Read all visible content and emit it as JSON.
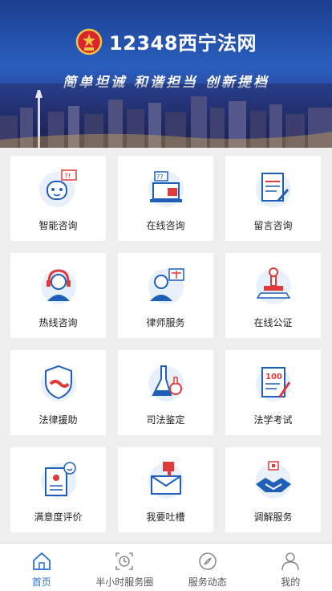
{
  "header": {
    "site_title": "12348西宁法网",
    "slogan": "简单坦诚  和谐担当  创新提档"
  },
  "services": [
    {
      "label": "智能咨询",
      "icon": "robot-icon"
    },
    {
      "label": "在线咨询",
      "icon": "laptop-chat-icon"
    },
    {
      "label": "留言咨询",
      "icon": "document-pen-icon"
    },
    {
      "label": "热线咨询",
      "icon": "headset-agent-icon"
    },
    {
      "label": "律师服务",
      "icon": "lawyer-icon"
    },
    {
      "label": "在线公证",
      "icon": "stamp-icon"
    },
    {
      "label": "法律援助",
      "icon": "shield-handshake-icon"
    },
    {
      "label": "司法鉴定",
      "icon": "flask-icon"
    },
    {
      "label": "法学考试",
      "icon": "exam-paper-icon"
    },
    {
      "label": "满意度评价",
      "icon": "rating-card-icon"
    },
    {
      "label": "我要吐槽",
      "icon": "complaint-mail-icon"
    },
    {
      "label": "调解服务",
      "icon": "handshake-icon"
    }
  ],
  "tabbar": {
    "items": [
      {
        "label": "首页",
        "icon": "home-icon",
        "active": true
      },
      {
        "label": "半小时服务圈",
        "icon": "clock-icon",
        "active": false
      },
      {
        "label": "服务动态",
        "icon": "compass-icon",
        "active": false
      },
      {
        "label": "我的",
        "icon": "user-icon",
        "active": false
      }
    ]
  },
  "colors": {
    "accent": "#2a6fd6",
    "icon_blue": "#1f5fb8",
    "icon_red": "#e03a3a",
    "banner_blue": "#2a5fbf"
  }
}
